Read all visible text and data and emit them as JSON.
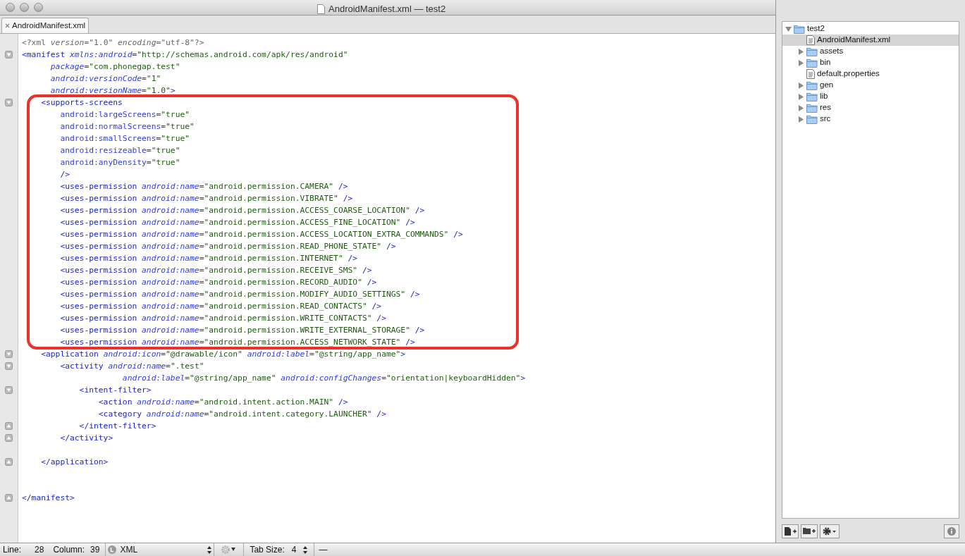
{
  "window": {
    "title": "AndroidManifest.xml — test2"
  },
  "tabs": [
    {
      "label": "AndroidManifest.xml",
      "selected": true
    }
  ],
  "code_lines": [
    {
      "kind": "plain",
      "highlighted": false,
      "segments": [
        {
          "kind": "decl",
          "text": "<?xml "
        },
        {
          "kind": "decl-attr",
          "text": "version"
        },
        {
          "kind": "decl",
          "text": "=\"1.0\" "
        },
        {
          "kind": "decl-attr",
          "text": "encoding"
        },
        {
          "kind": "decl",
          "text": "=\"utf-8\"?>"
        }
      ]
    },
    {
      "kind": "fold-start",
      "highlighted": false,
      "segments": [
        {
          "kind": "tag",
          "text": "<manifest "
        },
        {
          "kind": "attr",
          "text": "xmlns:android"
        },
        {
          "kind": "punct",
          "text": "="
        },
        {
          "kind": "value",
          "text": "\"http://schemas.android.com/apk/res/android\""
        }
      ]
    },
    {
      "kind": "plain",
      "highlighted": false,
      "segments": [
        {
          "kind": "attr",
          "text": "      package"
        },
        {
          "kind": "punct",
          "text": "="
        },
        {
          "kind": "value",
          "text": "\"com.phonegap.test\""
        }
      ]
    },
    {
      "kind": "plain",
      "highlighted": false,
      "segments": [
        {
          "kind": "attr",
          "text": "      android:versionCode"
        },
        {
          "kind": "punct",
          "text": "="
        },
        {
          "kind": "value",
          "text": "\"1\""
        }
      ]
    },
    {
      "kind": "plain",
      "highlighted": false,
      "segments": [
        {
          "kind": "attr",
          "text": "      android:versionName"
        },
        {
          "kind": "punct",
          "text": "="
        },
        {
          "kind": "value",
          "text": "\"1.0\""
        },
        {
          "kind": "tag",
          "text": ">"
        }
      ]
    },
    {
      "kind": "fold-start",
      "highlighted": true,
      "segments": [
        {
          "kind": "tag",
          "text": "    <supports-screens"
        }
      ]
    },
    {
      "kind": "plain",
      "highlighted": true,
      "segments": [
        {
          "kind": "attr-upright",
          "text": "        android:largeScreens"
        },
        {
          "kind": "punct",
          "text": "="
        },
        {
          "kind": "value",
          "text": "\"true\""
        }
      ]
    },
    {
      "kind": "plain",
      "highlighted": true,
      "segments": [
        {
          "kind": "attr-upright",
          "text": "        android:normalScreens"
        },
        {
          "kind": "punct",
          "text": "="
        },
        {
          "kind": "value",
          "text": "\"true\""
        }
      ]
    },
    {
      "kind": "plain",
      "highlighted": true,
      "segments": [
        {
          "kind": "attr-upright",
          "text": "        android:smallScreens"
        },
        {
          "kind": "punct",
          "text": "="
        },
        {
          "kind": "value",
          "text": "\"true\""
        }
      ]
    },
    {
      "kind": "plain",
      "highlighted": true,
      "segments": [
        {
          "kind": "attr-upright",
          "text": "        android:resizeable"
        },
        {
          "kind": "punct",
          "text": "="
        },
        {
          "kind": "value",
          "text": "\"true\""
        }
      ]
    },
    {
      "kind": "plain",
      "highlighted": true,
      "segments": [
        {
          "kind": "attr-upright",
          "text": "        android:anyDensity"
        },
        {
          "kind": "punct",
          "text": "="
        },
        {
          "kind": "value",
          "text": "\"true\""
        }
      ]
    },
    {
      "kind": "plain",
      "highlighted": true,
      "segments": [
        {
          "kind": "tag",
          "text": "        />"
        }
      ]
    },
    {
      "kind": "plain",
      "highlighted": true,
      "segments": [
        {
          "kind": "tag",
          "text": "        <uses-permission "
        },
        {
          "kind": "attr",
          "text": "android:name"
        },
        {
          "kind": "punct",
          "text": "="
        },
        {
          "kind": "value",
          "text": "\"android.permission.CAMERA\""
        },
        {
          "kind": "tag",
          "text": " />"
        }
      ]
    },
    {
      "kind": "plain",
      "highlighted": true,
      "segments": [
        {
          "kind": "tag",
          "text": "        <uses-permission "
        },
        {
          "kind": "attr",
          "text": "android:name"
        },
        {
          "kind": "punct",
          "text": "="
        },
        {
          "kind": "value",
          "text": "\"android.permission.VIBRATE\""
        },
        {
          "kind": "tag",
          "text": " />"
        }
      ]
    },
    {
      "kind": "plain",
      "highlighted": true,
      "segments": [
        {
          "kind": "tag",
          "text": "        <uses-permission "
        },
        {
          "kind": "attr",
          "text": "android:name"
        },
        {
          "kind": "punct",
          "text": "="
        },
        {
          "kind": "value",
          "text": "\"android.permission.ACCESS_COARSE_LOCATION\""
        },
        {
          "kind": "tag",
          "text": " />"
        }
      ]
    },
    {
      "kind": "plain",
      "highlighted": true,
      "segments": [
        {
          "kind": "tag",
          "text": "        <uses-permission "
        },
        {
          "kind": "attr",
          "text": "android:name"
        },
        {
          "kind": "punct",
          "text": "="
        },
        {
          "kind": "value",
          "text": "\"android.permission.ACCESS_FINE_LOCATION\""
        },
        {
          "kind": "tag",
          "text": " />"
        }
      ]
    },
    {
      "kind": "plain",
      "highlighted": true,
      "segments": [
        {
          "kind": "tag",
          "text": "        <uses-permission "
        },
        {
          "kind": "attr",
          "text": "android:name"
        },
        {
          "kind": "punct",
          "text": "="
        },
        {
          "kind": "value",
          "text": "\"android.permission.ACCESS_LOCATION_EXTRA_COMMANDS\""
        },
        {
          "kind": "tag",
          "text": " />"
        }
      ]
    },
    {
      "kind": "plain",
      "highlighted": true,
      "segments": [
        {
          "kind": "tag",
          "text": "        <uses-permission "
        },
        {
          "kind": "attr",
          "text": "android:name"
        },
        {
          "kind": "punct",
          "text": "="
        },
        {
          "kind": "value",
          "text": "\"android.permission.READ_PHONE_STATE\""
        },
        {
          "kind": "tag",
          "text": " />"
        }
      ]
    },
    {
      "kind": "plain",
      "highlighted": true,
      "segments": [
        {
          "kind": "tag",
          "text": "        <uses-permission "
        },
        {
          "kind": "attr",
          "text": "android:name"
        },
        {
          "kind": "punct",
          "text": "="
        },
        {
          "kind": "value",
          "text": "\"android.permission.INTERNET\""
        },
        {
          "kind": "tag",
          "text": " />"
        }
      ]
    },
    {
      "kind": "plain",
      "highlighted": true,
      "segments": [
        {
          "kind": "tag",
          "text": "        <uses-permission "
        },
        {
          "kind": "attr",
          "text": "android:name"
        },
        {
          "kind": "punct",
          "text": "="
        },
        {
          "kind": "value",
          "text": "\"android.permission.RECEIVE_SMS\""
        },
        {
          "kind": "tag",
          "text": " />"
        }
      ]
    },
    {
      "kind": "plain",
      "highlighted": true,
      "segments": [
        {
          "kind": "tag",
          "text": "        <uses-permission "
        },
        {
          "kind": "attr",
          "text": "android:name"
        },
        {
          "kind": "punct",
          "text": "="
        },
        {
          "kind": "value",
          "text": "\"android.permission.RECORD_AUDIO\""
        },
        {
          "kind": "tag",
          "text": " />"
        }
      ]
    },
    {
      "kind": "plain",
      "highlighted": true,
      "segments": [
        {
          "kind": "tag",
          "text": "        <uses-permission "
        },
        {
          "kind": "attr",
          "text": "android:name"
        },
        {
          "kind": "punct",
          "text": "="
        },
        {
          "kind": "value",
          "text": "\"android.permission.MODIFY_AUDIO_SETTINGS\""
        },
        {
          "kind": "tag",
          "text": " />"
        }
      ]
    },
    {
      "kind": "plain",
      "highlighted": true,
      "segments": [
        {
          "kind": "tag",
          "text": "        <uses-permission "
        },
        {
          "kind": "attr",
          "text": "android:name"
        },
        {
          "kind": "punct",
          "text": "="
        },
        {
          "kind": "value",
          "text": "\"android.permission.READ_CONTACTS\""
        },
        {
          "kind": "tag",
          "text": " />"
        }
      ]
    },
    {
      "kind": "plain",
      "highlighted": true,
      "segments": [
        {
          "kind": "tag",
          "text": "        <uses-permission "
        },
        {
          "kind": "attr",
          "text": "android:name"
        },
        {
          "kind": "punct",
          "text": "="
        },
        {
          "kind": "value",
          "text": "\"android.permission.WRITE_CONTACTS\""
        },
        {
          "kind": "tag",
          "text": " />"
        }
      ]
    },
    {
      "kind": "plain",
      "highlighted": true,
      "segments": [
        {
          "kind": "tag",
          "text": "        <uses-permission "
        },
        {
          "kind": "attr",
          "text": "android:name"
        },
        {
          "kind": "punct",
          "text": "="
        },
        {
          "kind": "value",
          "text": "\"android.permission.WRITE_EXTERNAL_STORAGE\""
        },
        {
          "kind": "tag",
          "text": " />"
        }
      ]
    },
    {
      "kind": "plain",
      "highlighted": true,
      "segments": [
        {
          "kind": "tag",
          "text": "        <uses-permission "
        },
        {
          "kind": "attr",
          "text": "android:name"
        },
        {
          "kind": "punct",
          "text": "="
        },
        {
          "kind": "value",
          "text": "\"android.permission.ACCESS_NETWORK_STATE\""
        },
        {
          "kind": "tag",
          "text": " />"
        }
      ]
    },
    {
      "kind": "fold-start",
      "highlighted": false,
      "segments": [
        {
          "kind": "tag",
          "text": "    <application "
        },
        {
          "kind": "attr",
          "text": "android:icon"
        },
        {
          "kind": "punct",
          "text": "="
        },
        {
          "kind": "value",
          "text": "\"@drawable/icon\""
        },
        {
          "kind": "attr",
          "text": " android:label"
        },
        {
          "kind": "punct",
          "text": "="
        },
        {
          "kind": "value",
          "text": "\"@string/app_name\""
        },
        {
          "kind": "tag",
          "text": ">"
        }
      ]
    },
    {
      "kind": "fold-start",
      "highlighted": false,
      "segments": [
        {
          "kind": "tag",
          "text": "        <activity "
        },
        {
          "kind": "attr",
          "text": "android:name"
        },
        {
          "kind": "punct",
          "text": "="
        },
        {
          "kind": "value",
          "text": "\".test\""
        }
      ]
    },
    {
      "kind": "plain",
      "highlighted": false,
      "segments": [
        {
          "kind": "attr",
          "text": "                     android:label"
        },
        {
          "kind": "punct",
          "text": "="
        },
        {
          "kind": "value",
          "text": "\"@string/app_name\""
        },
        {
          "kind": "attr",
          "text": " android:configChanges"
        },
        {
          "kind": "punct",
          "text": "="
        },
        {
          "kind": "value",
          "text": "\"orientation|keyboardHidden\""
        },
        {
          "kind": "tag",
          "text": ">"
        }
      ]
    },
    {
      "kind": "fold-start",
      "highlighted": false,
      "segments": [
        {
          "kind": "tag",
          "text": "            <intent-filter>"
        }
      ]
    },
    {
      "kind": "plain",
      "highlighted": false,
      "segments": [
        {
          "kind": "tag",
          "text": "                <action "
        },
        {
          "kind": "attr",
          "text": "android:name"
        },
        {
          "kind": "punct",
          "text": "="
        },
        {
          "kind": "value",
          "text": "\"android.intent.action.MAIN\""
        },
        {
          "kind": "tag",
          "text": " />"
        }
      ]
    },
    {
      "kind": "plain",
      "highlighted": false,
      "segments": [
        {
          "kind": "tag",
          "text": "                <category "
        },
        {
          "kind": "attr",
          "text": "android:name"
        },
        {
          "kind": "punct",
          "text": "="
        },
        {
          "kind": "value",
          "text": "\"android.intent.category.LAUNCHER\""
        },
        {
          "kind": "tag",
          "text": " />"
        }
      ]
    },
    {
      "kind": "fold-end",
      "highlighted": false,
      "segments": [
        {
          "kind": "tag",
          "text": "            </intent-filter>"
        }
      ]
    },
    {
      "kind": "fold-end",
      "highlighted": false,
      "segments": [
        {
          "kind": "tag",
          "text": "        </activity>"
        }
      ]
    },
    {
      "kind": "blank"
    },
    {
      "kind": "fold-end",
      "highlighted": false,
      "segments": [
        {
          "kind": "tag",
          "text": "    </application>"
        }
      ]
    },
    {
      "kind": "blank"
    },
    {
      "kind": "blank"
    },
    {
      "kind": "fold-end",
      "highlighted": false,
      "segments": [
        {
          "kind": "tag",
          "text": "</manifest>"
        }
      ]
    }
  ],
  "project_tree": [
    {
      "name": "test2",
      "kind": "folder",
      "expanded": true,
      "selected": false,
      "children": [
        {
          "name": "AndroidManifest.xml",
          "kind": "file",
          "selected": true
        },
        {
          "name": "assets",
          "kind": "folder",
          "expanded": false,
          "selected": false
        },
        {
          "name": "bin",
          "kind": "folder",
          "expanded": false,
          "selected": false
        },
        {
          "name": "default.properties",
          "kind": "file",
          "selected": false
        },
        {
          "name": "gen",
          "kind": "folder",
          "expanded": false,
          "selected": false
        },
        {
          "name": "lib",
          "kind": "folder",
          "expanded": false,
          "selected": false
        },
        {
          "name": "res",
          "kind": "folder",
          "expanded": false,
          "selected": false
        },
        {
          "name": "src",
          "kind": "folder",
          "expanded": false,
          "selected": false
        }
      ]
    }
  ],
  "status_bar": {
    "line_label": "Line:",
    "line": "28",
    "column_label": "Column:",
    "column": "39",
    "language": "XML",
    "tab_size_label": "Tab Size:",
    "tab_size": "4",
    "symbol": "—"
  }
}
